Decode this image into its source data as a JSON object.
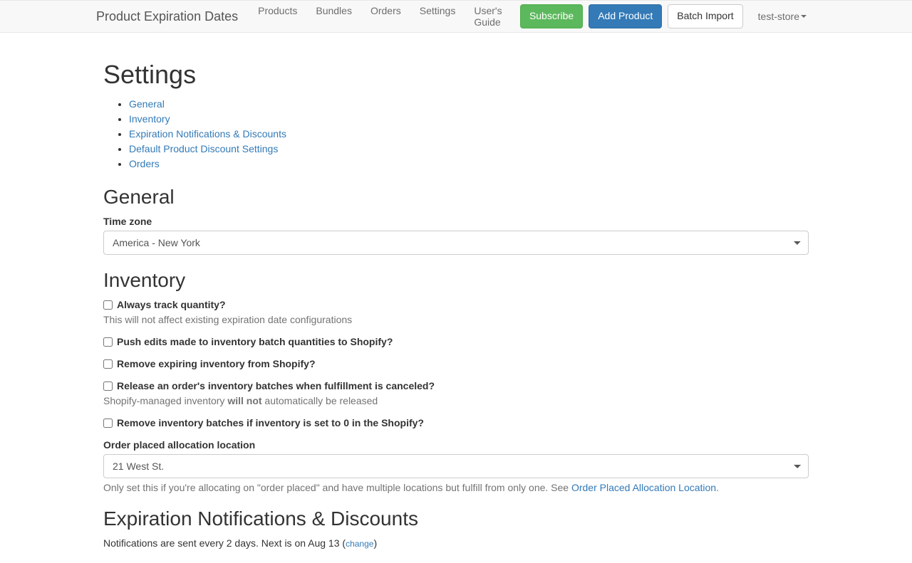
{
  "navbar": {
    "brand": "Product Expiration Dates",
    "links": [
      {
        "label": "Products"
      },
      {
        "label": "Bundles"
      },
      {
        "label": "Orders"
      },
      {
        "label": "Settings"
      },
      {
        "label": "User's Guide"
      }
    ],
    "subscribe": "Subscribe",
    "add_product": "Add Product",
    "batch_import": "Batch Import",
    "store": "test-store"
  },
  "page": {
    "title": "Settings",
    "toc": [
      "General",
      "Inventory",
      "Expiration Notifications & Discounts",
      "Default Product Discount Settings",
      "Orders"
    ]
  },
  "general": {
    "heading": "General",
    "timezone_label": "Time zone",
    "timezone_value": "America - New York"
  },
  "inventory": {
    "heading": "Inventory",
    "always_track": "Always track quantity?",
    "always_track_help": "This will not affect existing expiration date configurations",
    "push_edits": "Push edits made to inventory batch quantities to Shopify?",
    "remove_expiring": "Remove expiring inventory from Shopify?",
    "release_canceled": "Release an order's inventory batches when fulfillment is canceled?",
    "release_help_pre": "Shopify-managed inventory ",
    "release_help_strong": "will not",
    "release_help_post": " automatically be released",
    "remove_zero": "Remove inventory batches if inventory is set to 0 in the Shopify?",
    "allocation_label": "Order placed allocation location",
    "allocation_value": "21 West St.",
    "allocation_help_pre": "Only set this if you're allocating on \"order placed\" and have multiple locations but fulfill from only one. See ",
    "allocation_help_link": "Order Placed Allocation Location",
    "allocation_help_post": "."
  },
  "expiration": {
    "heading": "Expiration Notifications & Discounts",
    "notif_text_pre": "Notifications are sent every 2 days. Next is on Aug 13 (",
    "notif_change": "change",
    "notif_text_post": ")"
  }
}
